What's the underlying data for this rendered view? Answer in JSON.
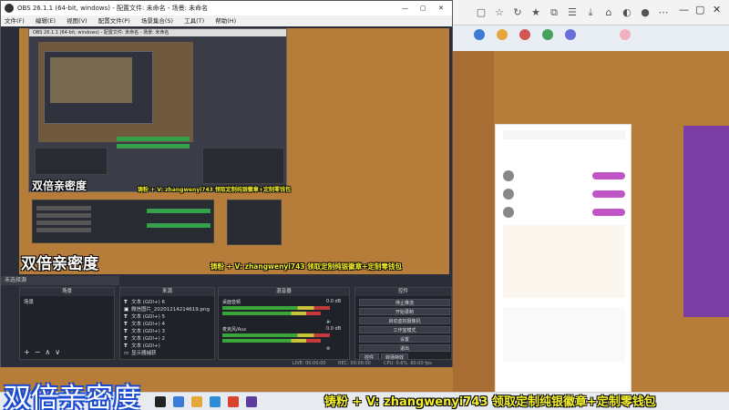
{
  "obs": {
    "title": "OBS 26.1.1 (64-bit, windows) - 配置文件: 未命名 - 场景: 未命名",
    "menu": [
      "文件(F)",
      "编辑(E)",
      "视图(V)",
      "配置文件(P)",
      "场景集合(S)",
      "工具(T)",
      "帮助(H)"
    ],
    "nested_title": "OBS 26.1.1 (64-bit, windows) - 配置文件: 未命名 - 场景: 未命名",
    "selected_source": "未选择源",
    "docks": {
      "scenes": "场景",
      "sources": "来源",
      "mixer": "混音器",
      "controls": "控件"
    },
    "scenes_items": [
      "场景"
    ],
    "sources_items": [
      {
        "icon": "T",
        "label": "文本 (GDI+) 6"
      },
      {
        "icon": "▣",
        "label": "微信图片_20201214214619.png"
      },
      {
        "icon": "T",
        "label": "文本 (GDI+) 5"
      },
      {
        "icon": "T",
        "label": "文本 (GDI+) 4"
      },
      {
        "icon": "T",
        "label": "文本 (GDI+) 3"
      },
      {
        "icon": "T",
        "label": "文本 (GDI+) 2"
      },
      {
        "icon": "T",
        "label": "文本 (GDI+)"
      },
      {
        "icon": "▭",
        "label": "显示器捕获"
      }
    ],
    "mixer_channels": [
      {
        "label": "桌面音频",
        "db": "0.0 dB"
      },
      {
        "label": "麦克风/Aux",
        "db": "0.0 dB"
      }
    ],
    "controls": [
      "停止推流",
      "开始录制",
      "启动虚拟摄像机",
      "工作室模式",
      "设置",
      "退出"
    ],
    "control_tabs": [
      "控件",
      "转场特效"
    ],
    "status": {
      "live": "LIVE: 00:00:00",
      "rec": "REC: 00:00:00",
      "cpu": "CPU: 0.6%, 60.00 fps"
    }
  },
  "overlays": {
    "shuangbei_small": "双倍亲密度",
    "shuangbei_mid": "双倍亲密度",
    "shuangbei_big": "双倍亲密度",
    "promo_small": "铸粉 + V: zhangwenyi743 领取定制纯银徽章+定制零钱包",
    "promo_mid": "铸粉 + V: zhangwenyi743 领取定制纯银徽章+定制零钱包",
    "promo_big": "铸粉 + V: zhangwenyi743 领取定制纯银徽章+定制零钱包"
  },
  "colors": {
    "obs_bg": "#2b2e38",
    "overlay_yellow": "#f4f02a",
    "overlay_blue_outline": "#1a4bd0",
    "site_brown": "#b67c3a"
  },
  "icons": [
    "obs-logo-icon",
    "minimize-icon",
    "maximize-icon",
    "close-icon",
    "eye-icon",
    "lock-icon",
    "gear-icon",
    "speaker-icon",
    "plus-icon",
    "minus-icon",
    "up-icon",
    "down-icon"
  ]
}
